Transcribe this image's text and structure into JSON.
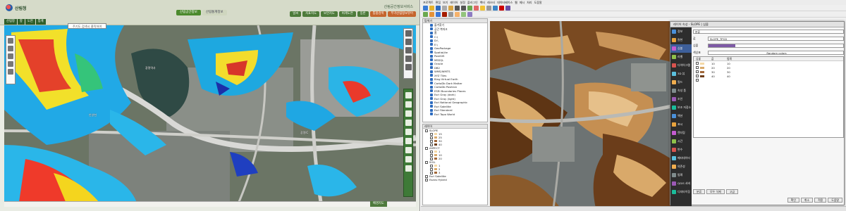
{
  "left_app": {
    "service_title": "산림공간정보서비스",
    "logo_text": "산림청",
    "menu_tabs": [
      {
        "label": "산림공간정보",
        "active": true
      },
      {
        "label": "산림통계정보",
        "active": false
      }
    ],
    "top_buttons": [
      "날씨",
      "지표지도",
      "보안지도",
      "비계도면",
      "임반",
      "통합검색",
      "부가산림정보뷰어"
    ],
    "sub_tabs": [
      "산림청",
      "항",
      "도면",
      "통계"
    ],
    "search_placeholder": "주기도 검색시 클릭하여",
    "map_labels": [
      "광명역사",
      "광명IC",
      "안양천"
    ],
    "basemap_button": "배경지도"
  },
  "qgis": {
    "menus": [
      "프로젝트",
      "편집",
      "보기",
      "레이어",
      "설정",
      "플러그인",
      "벡터",
      "래스터",
      "데이터베이스",
      "웹",
      "메시",
      "처리",
      "도움말"
    ],
    "browser_panel_title": "탐색기",
    "browser_items": [
      "즐겨찾기",
      "공간 북마크",
      "홈",
      "C:\\",
      "D:\\",
      "E:\\",
      "GeoPackage",
      "SpatiaLite",
      "PostGIS",
      "MSSQL",
      "Oracle",
      "DB2",
      "WMS/WMTS",
      "XYZ Tiles",
      "Bing Virtual Earth",
      "CartoDb Dark Matter",
      "CartoDb Positron",
      "ESRI Boundaries Places",
      "Esri Gray (dark)",
      "Esri Gray (light)",
      "Esri National Geographic",
      "Esri Satellite",
      "Esri Standard",
      "Esri Topo World"
    ],
    "layers_panel_title": "레이어",
    "layers": [
      {
        "name": "SLOPE",
        "classes": [
          "15",
          "25",
          "30",
          "40"
        ]
      },
      {
        "name": "ASPECT",
        "classes": [
          "1",
          "10",
          "20"
        ]
      },
      {
        "name": "SOIL",
        "classes": [
          "1",
          "2",
          "3"
        ]
      },
      {
        "name": "Esri Satellite",
        "classes": []
      },
      {
        "name": "Esans Hybrid",
        "classes": []
      }
    ],
    "layer_swatch_colors": [
      "#f4d9a8",
      "#d8a96a",
      "#a3693a",
      "#6e3f1c"
    ],
    "dialog": {
      "title": "레이어 속성 - SLOPE | 심볼",
      "sidebar": [
        "정보",
        "원천",
        "심볼",
        "라벨",
        "다이어그램",
        "3D 뷰",
        "필드",
        "속성 폼",
        "조인",
        "보조 저장소",
        "액션",
        "표시",
        "렌더링",
        "시간",
        "변수",
        "메타데이터",
        "의존성",
        "범례",
        "QGIS 서버",
        "디지타이징"
      ],
      "renderer": "분류",
      "value_field": "SLOPE_TPCD",
      "symbol_label": "심볼",
      "color_ramp_label": "색상표",
      "color_ramp_value": "Random colors",
      "table_headers": [
        "심볼",
        "값",
        "범례"
      ],
      "classes": [
        {
          "value": "10",
          "legend": "10",
          "color": "#f4d9a8"
        },
        {
          "value": "20",
          "legend": "20",
          "color": "#d8a96a"
        },
        {
          "value": "30",
          "legend": "30",
          "color": "#a3693a"
        },
        {
          "value": "40",
          "legend": "40",
          "color": "#6e3f1c"
        },
        {
          "value": "",
          "legend": "",
          "color": "#ffffff"
        }
      ],
      "buttons": [
        "분류",
        "모두 삭제",
        "고급"
      ],
      "ok_buttons": [
        "확인",
        "취소",
        "적용",
        "도움말"
      ]
    }
  },
  "colors": {
    "portal_green": "#4c8a2d",
    "qgis_dark_side": "#2d2d2d",
    "brown_dark": "#6e3f1c",
    "brown_light": "#d8a96a"
  }
}
